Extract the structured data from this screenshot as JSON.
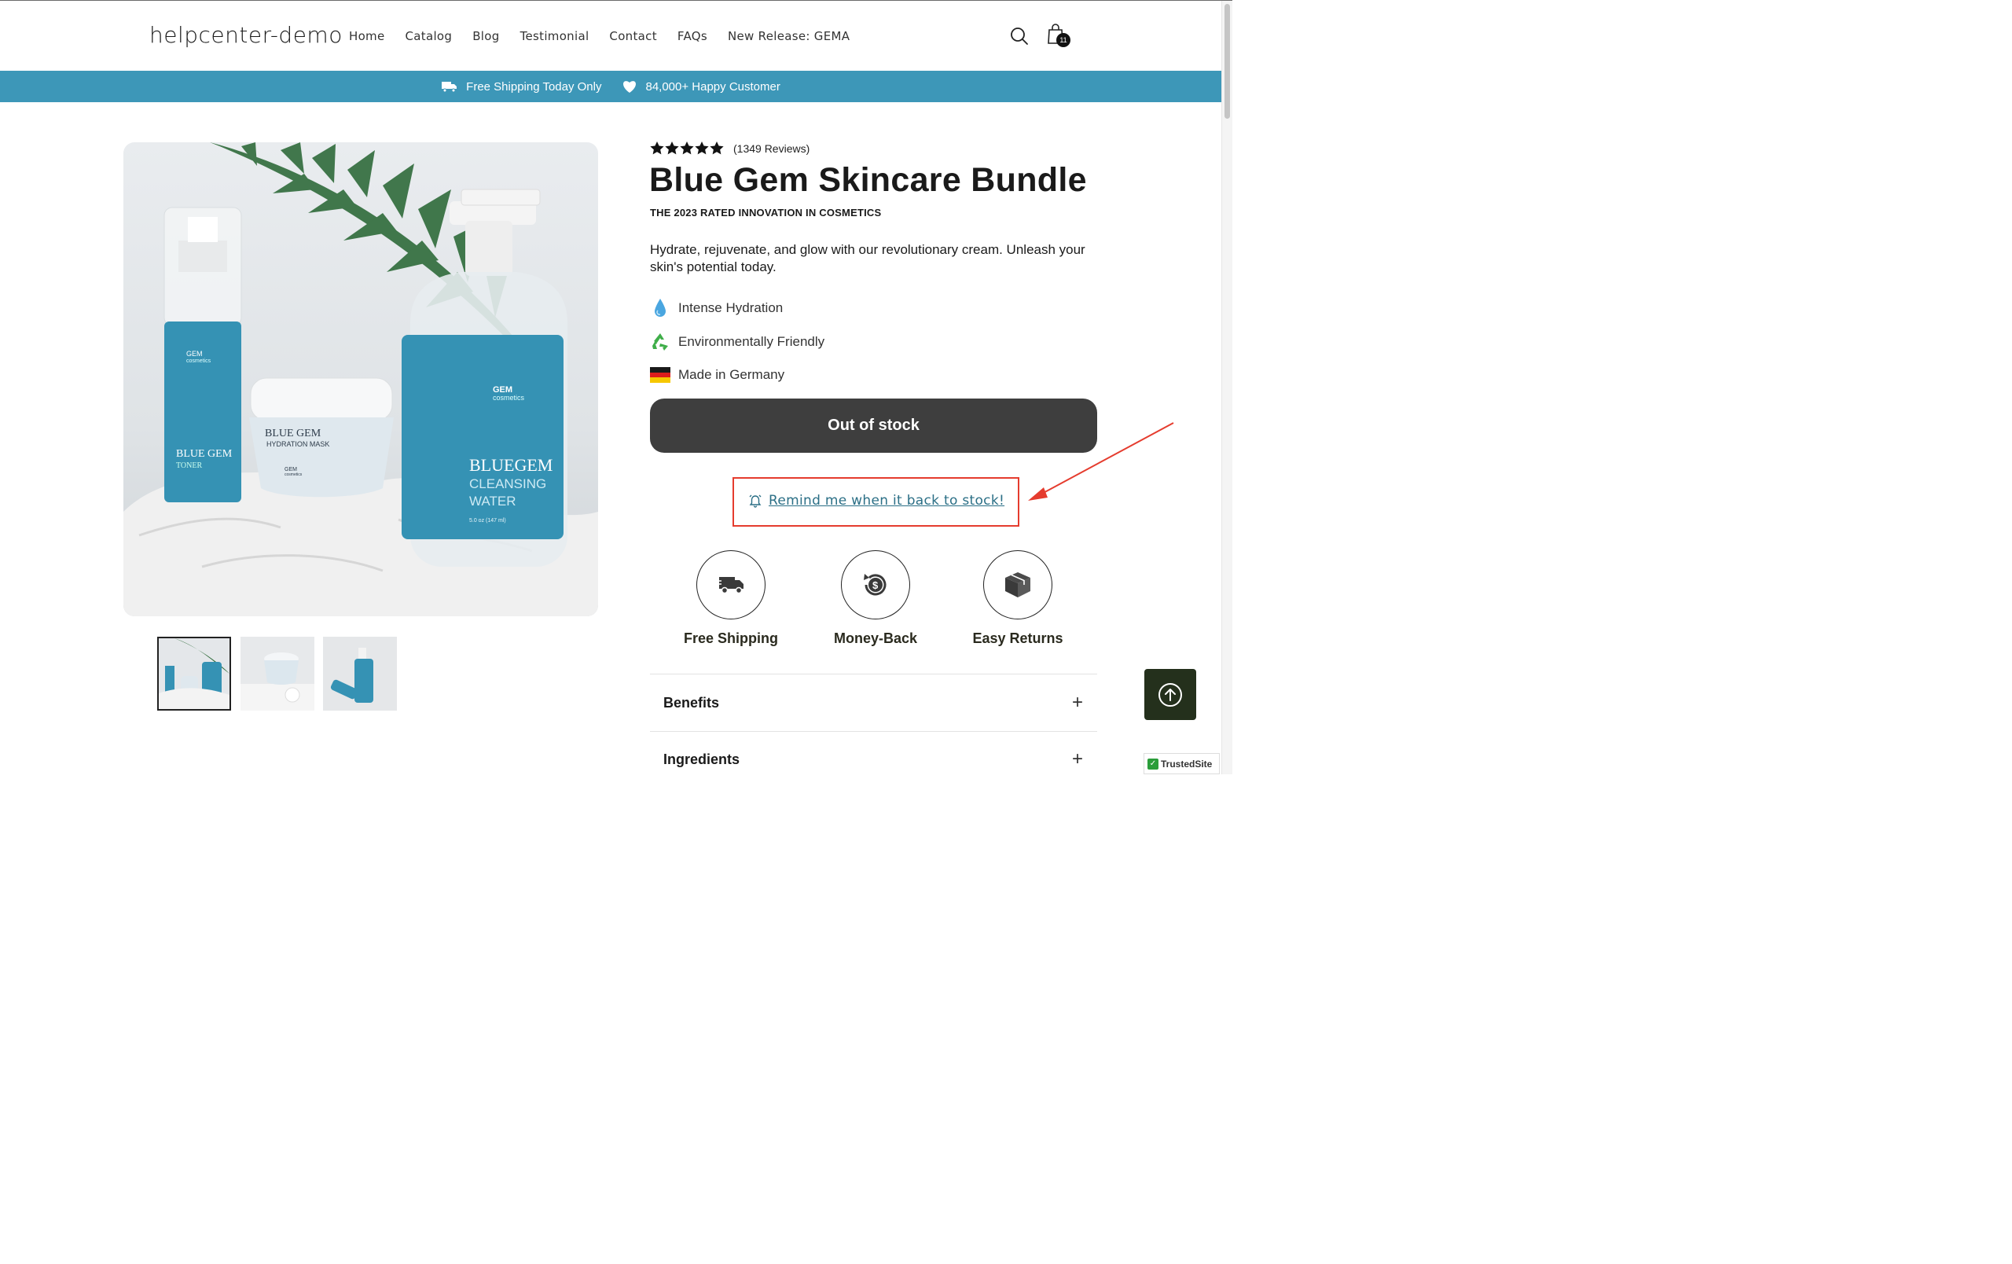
{
  "header": {
    "logo": "helpcenter-demo",
    "nav": [
      "Home",
      "Catalog",
      "Blog",
      "Testimonial",
      "Contact",
      "FAQs",
      "New Release: GEMA"
    ],
    "cart_count": "11",
    "icons": [
      "search-icon",
      "cart-icon"
    ]
  },
  "announcement": {
    "shipping": "Free Shipping Today Only",
    "customers": "84,000+ Happy Customer",
    "bg_color": "#3d97b8"
  },
  "product": {
    "rating": 5,
    "reviews": "(1349 Reviews)",
    "title": "Blue Gem Skincare Bundle",
    "subtitle": "THE 2023 RATED INNOVATION IN COSMETICS",
    "description": "Hydrate, rejuvenate, and glow with our revolutionary cream. Unleash your skin's potential today.",
    "features": [
      {
        "icon": "water-drop-icon",
        "label": "Intense Hydration"
      },
      {
        "icon": "recycle-icon",
        "label": "Environmentally Friendly"
      },
      {
        "icon": "germany-flag-icon",
        "label": "Made in Germany"
      }
    ],
    "stock_button": "Out of stock",
    "remind_link": "Remind me when it back to stock!",
    "perks": [
      "Free Shipping",
      "Money-Back",
      "Easy Returns"
    ],
    "accordion": [
      "Benefits",
      "Ingredients"
    ]
  },
  "image_labels": {
    "toner_brand": "GEM",
    "toner_brand_sub": "cosmetics",
    "toner": "BLUE GEM",
    "toner_sub": "TONER",
    "mask": "BLUE GEM",
    "mask_sub": "HYDRATION MASK",
    "mask_brand": "GEM",
    "mask_brand_sub": "cosmetics",
    "water_brand": "GEM",
    "water_brand_sub": "cosmetics",
    "water": "BLUEGEM",
    "water_sub1": "CLEANSING",
    "water_sub2": "WATER",
    "water_size": "5.0 oz (147 ml)"
  },
  "badge": {
    "trusted": "TrustedSite"
  },
  "colors": {
    "accent": "#3d97b8",
    "annotation": "#e53c2e",
    "button_dark": "#3e3e3e",
    "link": "#2b6f86"
  }
}
